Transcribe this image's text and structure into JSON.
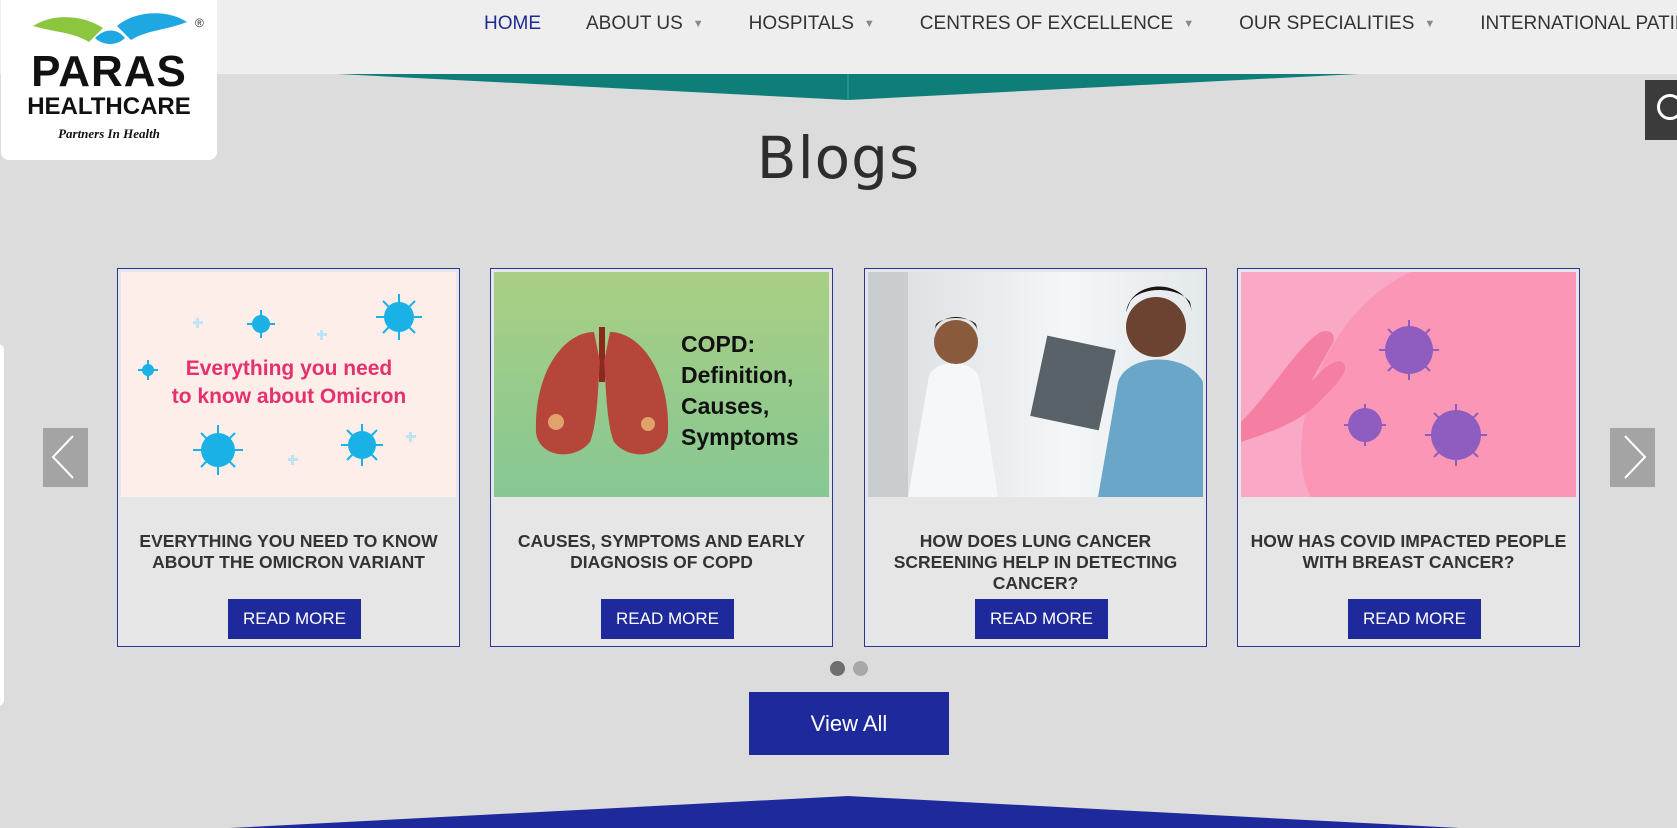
{
  "logo": {
    "line1": "PARAS",
    "line2": "HEALTHCARE",
    "tagline": "Partners In Health",
    "reg": "®"
  },
  "nav": {
    "items": [
      {
        "label": "HOME",
        "dropdown": false
      },
      {
        "label": "ABOUT US",
        "dropdown": true
      },
      {
        "label": "HOSPITALS",
        "dropdown": true
      },
      {
        "label": "CENTRES OF EXCELLENCE",
        "dropdown": true
      },
      {
        "label": "OUR SPECIALITIES",
        "dropdown": true
      },
      {
        "label": "INTERNATIONAL PATIENT",
        "dropdown": false
      }
    ],
    "caret": "▼"
  },
  "section": {
    "title": "Blogs"
  },
  "cards": [
    {
      "image_heading_line1": "Everything you need",
      "image_heading_line2": "to know about Omicron",
      "title": "EVERYTHING YOU NEED TO KNOW ABOUT THE OMICRON VARIANT",
      "button": "READ MORE"
    },
    {
      "image_heading_line1": "COPD:",
      "image_heading_line2": "Definition,",
      "image_heading_line3": "Causes,",
      "image_heading_line4": "Symptoms",
      "title": "CAUSES, SYMPTOMS AND EARLY DIAGNOSIS OF COPD",
      "button": "READ MORE"
    },
    {
      "title": "HOW DOES LUNG CANCER SCREENING HELP IN DETECTING CANCER?",
      "button": "READ MORE"
    },
    {
      "title": "HOW HAS COVID IMPACTED PEOPLE WITH BREAST CANCER?",
      "button": "READ MORE"
    }
  ],
  "carousel": {
    "pages": 2,
    "active_page": 1
  },
  "view_all": "View All",
  "colors": {
    "brand_blue": "#1e2a9c",
    "teal": "#0f7d78",
    "nav_active": "#1e2a8f",
    "bg": "#dcdcdc"
  }
}
